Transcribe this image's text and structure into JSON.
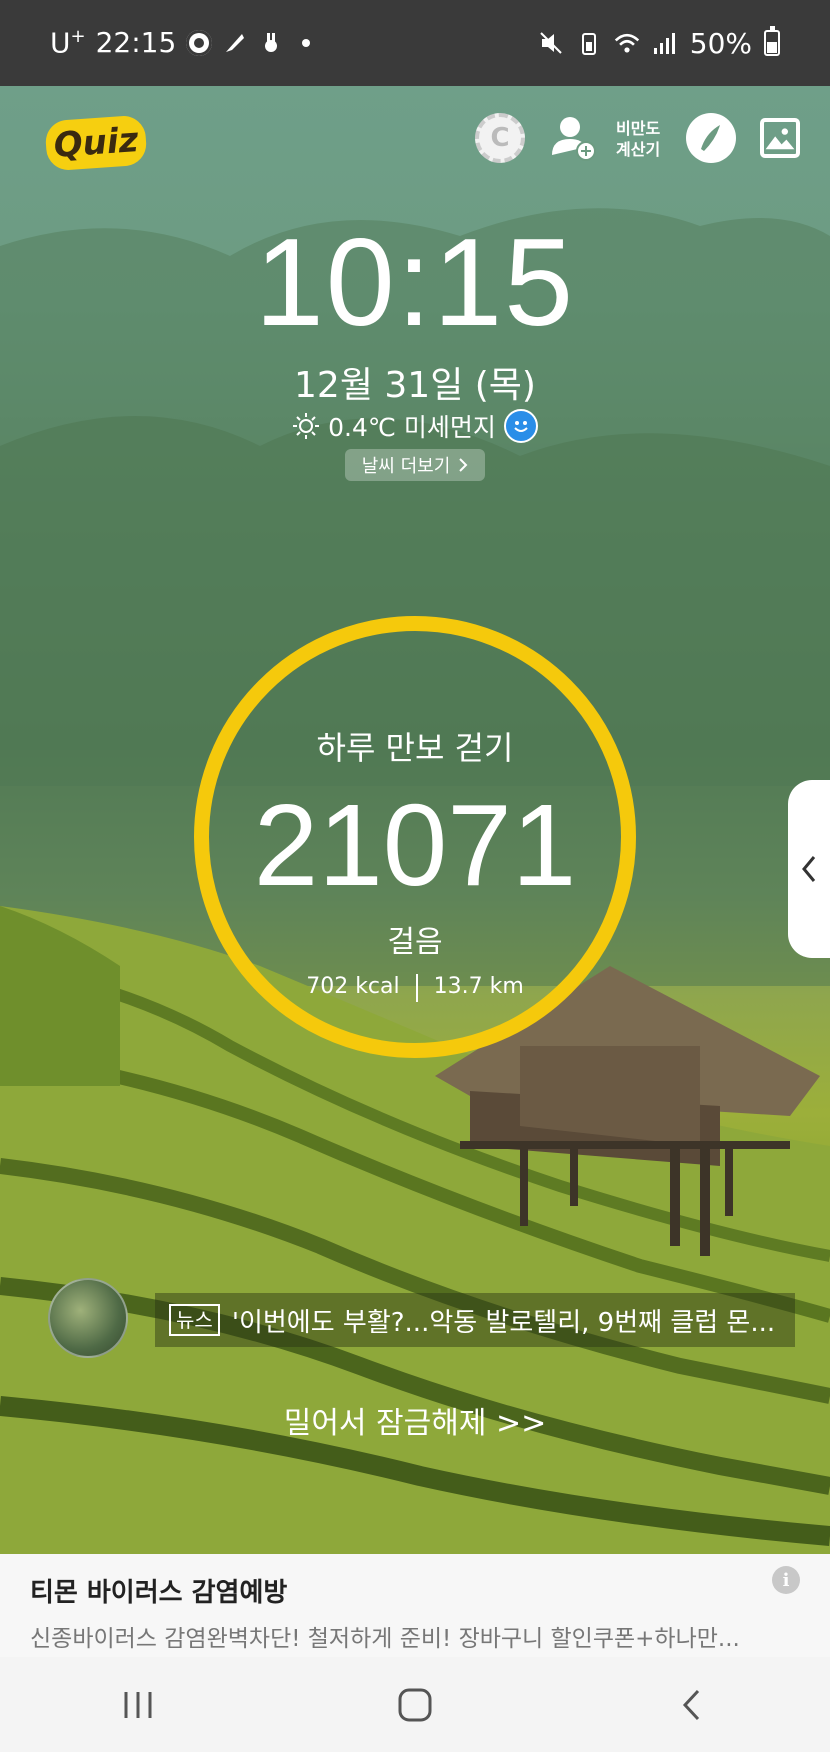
{
  "status_bar": {
    "carrier": "U",
    "carrier_plus": "+",
    "time": "22:15",
    "battery": "50%"
  },
  "top_bar": {
    "quiz_label": "Quiz",
    "bmi_label_line1": "비만도",
    "bmi_label_line2": "계산기"
  },
  "lockscreen": {
    "clock": "10:15",
    "date": "12월 31일 (목)",
    "weather": "0.4℃ 미세먼지",
    "weather_more": "날씨 더보기"
  },
  "pedometer": {
    "title": "하루 만보 걷기",
    "steps": "21071",
    "unit": "걸음",
    "kcal": "702 kcal",
    "distance": "13.7 km",
    "ring_color": "#f5c90c"
  },
  "news": {
    "tag": "뉴스",
    "headline": "'이번에도 부활?...악동 발로텔리, 9번째 클럽 몬..."
  },
  "unlock": {
    "label": "밀어서 잠금해제 >>"
  },
  "ad": {
    "title": "티몬 바이러스 감염예방",
    "description": "신종바이러스 감염완벽차단! 철저하게 준비! 장바구니 할인쿠폰+하나만...",
    "info_icon": "i"
  },
  "icons": {
    "coin": "C"
  }
}
